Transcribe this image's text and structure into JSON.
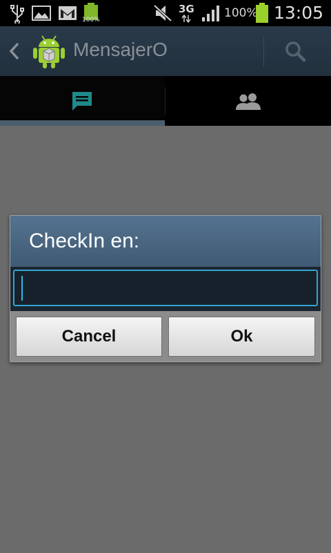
{
  "status_bar": {
    "battery_small_label": "100%",
    "network_label": "3G",
    "battery_percent": "100%",
    "time": "13:05",
    "icons": [
      "usb-icon",
      "image-icon",
      "gmail-icon",
      "battery-small-icon",
      "mute-icon",
      "data-arrows-icon",
      "signal-icon",
      "battery-icon"
    ]
  },
  "action_bar": {
    "title": "MensajerO",
    "icons": [
      "up-chevron-icon",
      "android-app-icon",
      "search-icon"
    ]
  },
  "tabs": [
    {
      "name": "messages",
      "icon": "chat-icon",
      "selected": true
    },
    {
      "name": "contacts",
      "icon": "people-icon",
      "selected": false
    }
  ],
  "dialog": {
    "title": "CheckIn en:",
    "input_value": "",
    "cancel_label": "Cancel",
    "ok_label": "Ok"
  },
  "colors": {
    "accent": "#33b5e5",
    "tab_icon_selected": "#1f8a8a",
    "background": "#6b6b6b"
  }
}
